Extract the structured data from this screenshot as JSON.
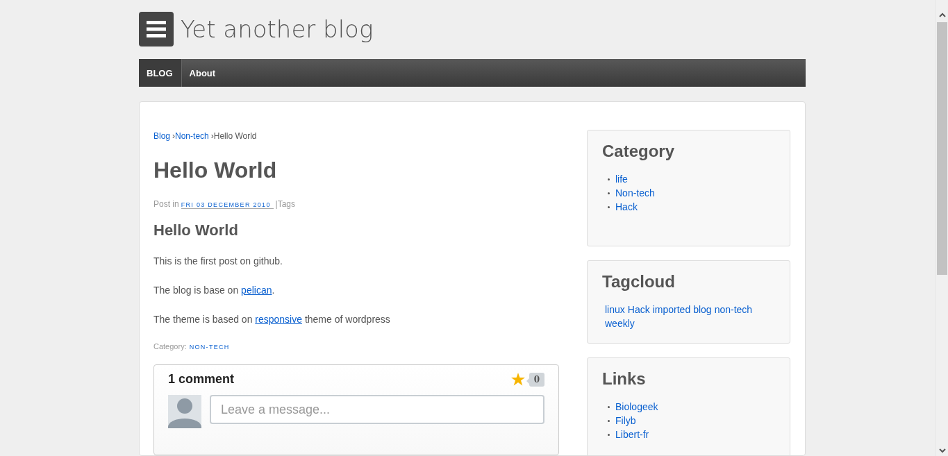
{
  "site": {
    "title": "Yet another blog"
  },
  "nav": [
    {
      "label": "BLOG",
      "selected": true
    },
    {
      "label": "About",
      "selected": false
    }
  ],
  "breadcrumb": [
    {
      "text": "Blog",
      "kind": "link"
    },
    {
      "text": "›",
      "kind": "separator"
    },
    {
      "text": "Non-tech",
      "kind": "link"
    },
    {
      "text": "›",
      "kind": "separator"
    },
    {
      "text": "Hello World",
      "kind": "current"
    }
  ],
  "post": {
    "title": "Hello World",
    "meta": [
      {
        "text": "Post in",
        "kind": "plain"
      },
      {
        "text": "FRI 03 DECEMBER 2010 ",
        "kind": "date"
      },
      {
        "text": "|Tags",
        "kind": "plain"
      }
    ],
    "heading": "Hello World",
    "paragraphs": [
      [
        {
          "text": "This is the first post on github.",
          "kind": "plain"
        }
      ],
      [
        {
          "text": "The blog is base on ",
          "kind": "plain"
        },
        {
          "text": "pelican",
          "kind": "link"
        },
        {
          "text": ".",
          "kind": "plain"
        }
      ],
      [
        {
          "text": "The theme is based on ",
          "kind": "plain"
        },
        {
          "text": "responsive",
          "kind": "link"
        },
        {
          "text": " theme of wordpress",
          "kind": "plain"
        }
      ]
    ],
    "category_label": "Category:",
    "category": "NON-TECH"
  },
  "comments": {
    "count_label": "1 comment",
    "star_count": "0",
    "placeholder": "Leave a message..."
  },
  "sidebar": [
    {
      "title": "Category",
      "kind": "list",
      "items": [
        "life",
        "Non-tech",
        "Hack"
      ]
    },
    {
      "title": "Tagcloud",
      "kind": "cloud",
      "items": [
        "linux",
        "Hack",
        "imported",
        "blog",
        "non-tech",
        "weekly"
      ]
    },
    {
      "title": "Links",
      "kind": "list",
      "items": [
        "Biologeek",
        "Filyb",
        "Libert-fr"
      ]
    }
  ]
}
